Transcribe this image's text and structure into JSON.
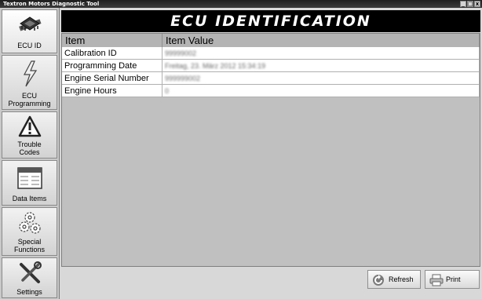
{
  "window": {
    "title": "Textron Motors Diagnostic Tool",
    "min": "_",
    "max": "□",
    "close": "x"
  },
  "sidebar": {
    "items": [
      {
        "label": "ECU ID",
        "icon": "chip-icon"
      },
      {
        "label": "ECU\nProgramming",
        "icon": "lightning-icon"
      },
      {
        "label": "Trouble\nCodes",
        "icon": "warning-icon"
      },
      {
        "label": "Data Items",
        "icon": "window-list-icon"
      },
      {
        "label": "Special\nFunctions",
        "icon": "gears-icon"
      },
      {
        "label": "Settings",
        "icon": "tools-icon"
      }
    ]
  },
  "header": {
    "title": "ECU IDENTIFICATION"
  },
  "table": {
    "columns": [
      "Item",
      "Item Value"
    ],
    "rows": [
      {
        "item": "Calibration ID",
        "value": "99999002"
      },
      {
        "item": "Programming Date",
        "value": "Freitag, 23. März 2012 15:34:19"
      },
      {
        "item": "Engine Serial Number",
        "value": "999999002"
      },
      {
        "item": "Engine Hours",
        "value": "0"
      }
    ]
  },
  "buttons": {
    "refresh": "Refresh",
    "print": "Print"
  }
}
